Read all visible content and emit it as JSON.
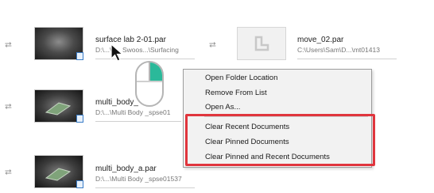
{
  "recent_files": [
    {
      "name": "surface lab 2-01.par",
      "path": "D:\\...\\F... Swoos...\\Surfacing"
    },
    {
      "name": "move_02.par",
      "path": "C:\\Users\\Sam\\D...\\mt01413"
    },
    {
      "name": "multi_body_",
      "path": "D:\\...\\Multi Body _spse01"
    },
    {
      "name": "multi_body_a.par",
      "path": "D:\\...\\Multi Body _spse01537"
    }
  ],
  "context_menu": {
    "items": [
      "Open Folder Location",
      "Remove From List",
      "Open As...",
      "Clear Recent Documents",
      "Clear Pinned Documents",
      "Clear Pinned and Recent Documents"
    ]
  },
  "icons": {
    "pin": "pin-icon",
    "cursor": "arrow-cursor-icon",
    "mouse": "mouse-right-click-icon",
    "file_placeholder": "document-placeholder-icon",
    "part_badge": "part-file-badge-icon"
  },
  "colors": {
    "highlight_box": "#e0353d",
    "mouse_right_button": "#2bb99a"
  }
}
